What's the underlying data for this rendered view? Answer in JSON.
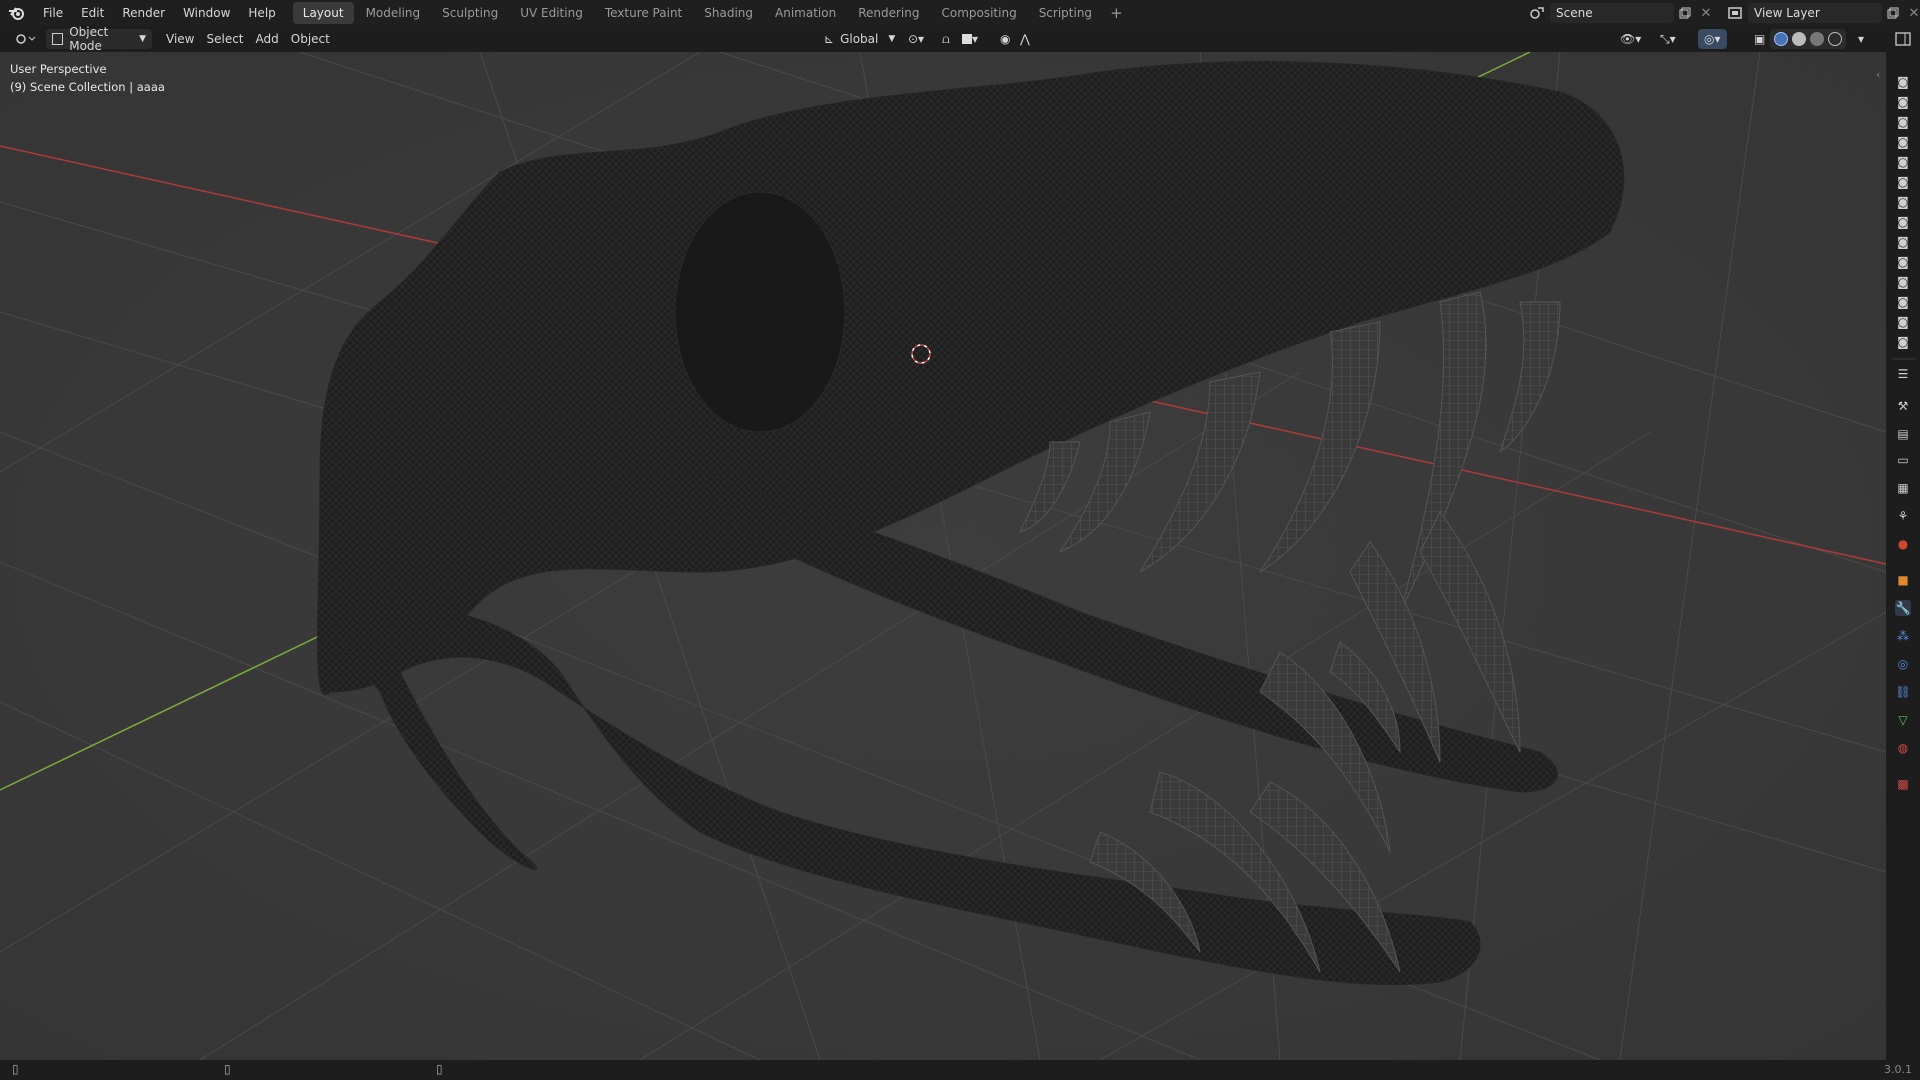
{
  "menu": {
    "file": "File",
    "edit": "Edit",
    "render": "Render",
    "window": "Window",
    "help": "Help"
  },
  "workspaces": [
    "Layout",
    "Modeling",
    "Sculpting",
    "UV Editing",
    "Texture Paint",
    "Shading",
    "Animation",
    "Rendering",
    "Compositing",
    "Scripting"
  ],
  "active_workspace": "Layout",
  "scene": {
    "name": "Scene"
  },
  "view_layer": {
    "name": "View Layer"
  },
  "header": {
    "mode": "Object Mode",
    "view": "View",
    "select": "Select",
    "add": "Add",
    "object": "Object",
    "orientation": "Global"
  },
  "viewport": {
    "perspective": "User Perspective",
    "collection": "(9) Scene Collection | aaaa"
  },
  "status": {
    "version": "3.0.1"
  },
  "colors": {
    "x_axis": "#c43c3c",
    "y_axis": "#7fb83a",
    "grid": "#444444",
    "bg": "#393939",
    "accent": "#4772b3"
  }
}
